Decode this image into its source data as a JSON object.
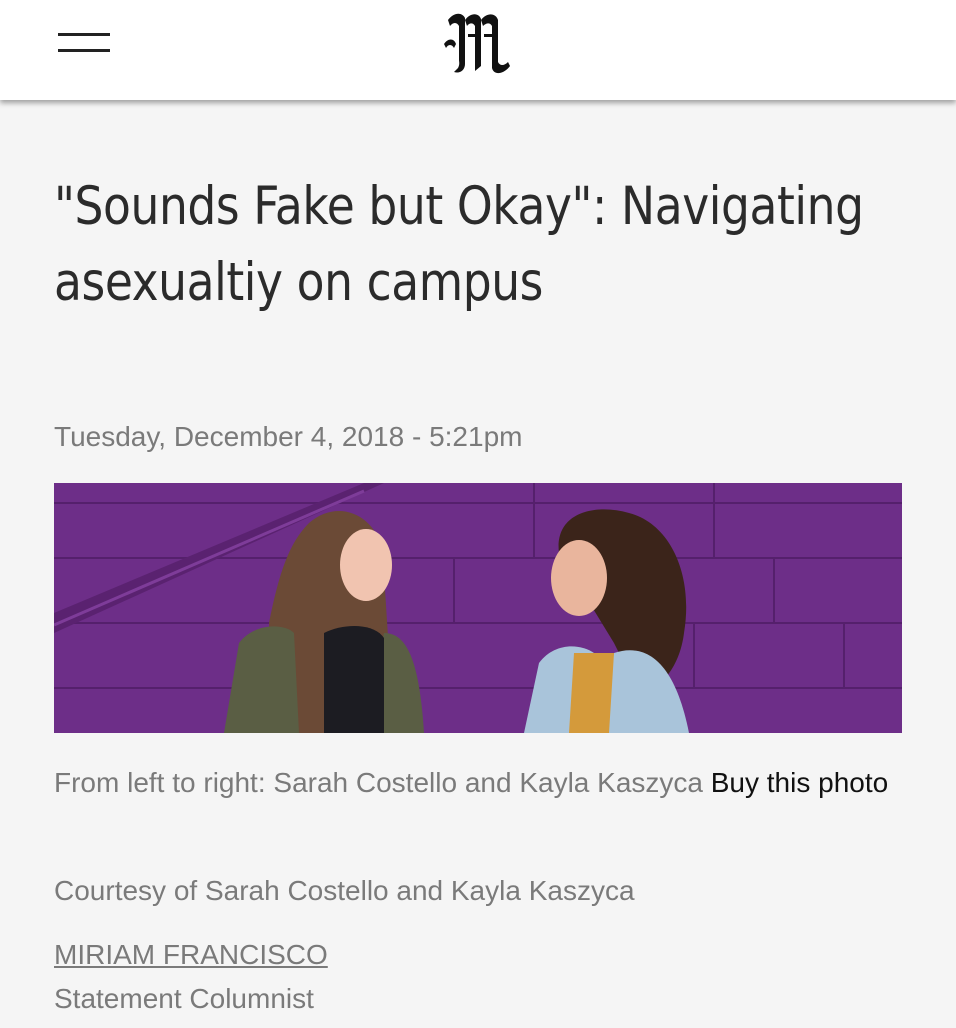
{
  "header": {
    "menu_icon": "hamburger-menu-icon",
    "logo_letter": "M"
  },
  "article": {
    "headline": "\"Sounds Fake but Okay\": Navigating asexualtiy on campus",
    "dateline": "Tuesday, December 4, 2018 - 5:21pm",
    "photo_caption": "From left to right: Sarah Costello and Kayla Kaszyca",
    "buy_photo_label": "Buy this photo",
    "photo_credit": "Courtesy of Sarah Costello and Kayla Kaszyca",
    "author_name": "MIRIAM FRANCISCO",
    "author_role": "Statement Columnist"
  },
  "colors": {
    "wall_purple": "#6a2d84",
    "text_gray": "#7a7a7a",
    "headline": "#2b2b2b"
  }
}
